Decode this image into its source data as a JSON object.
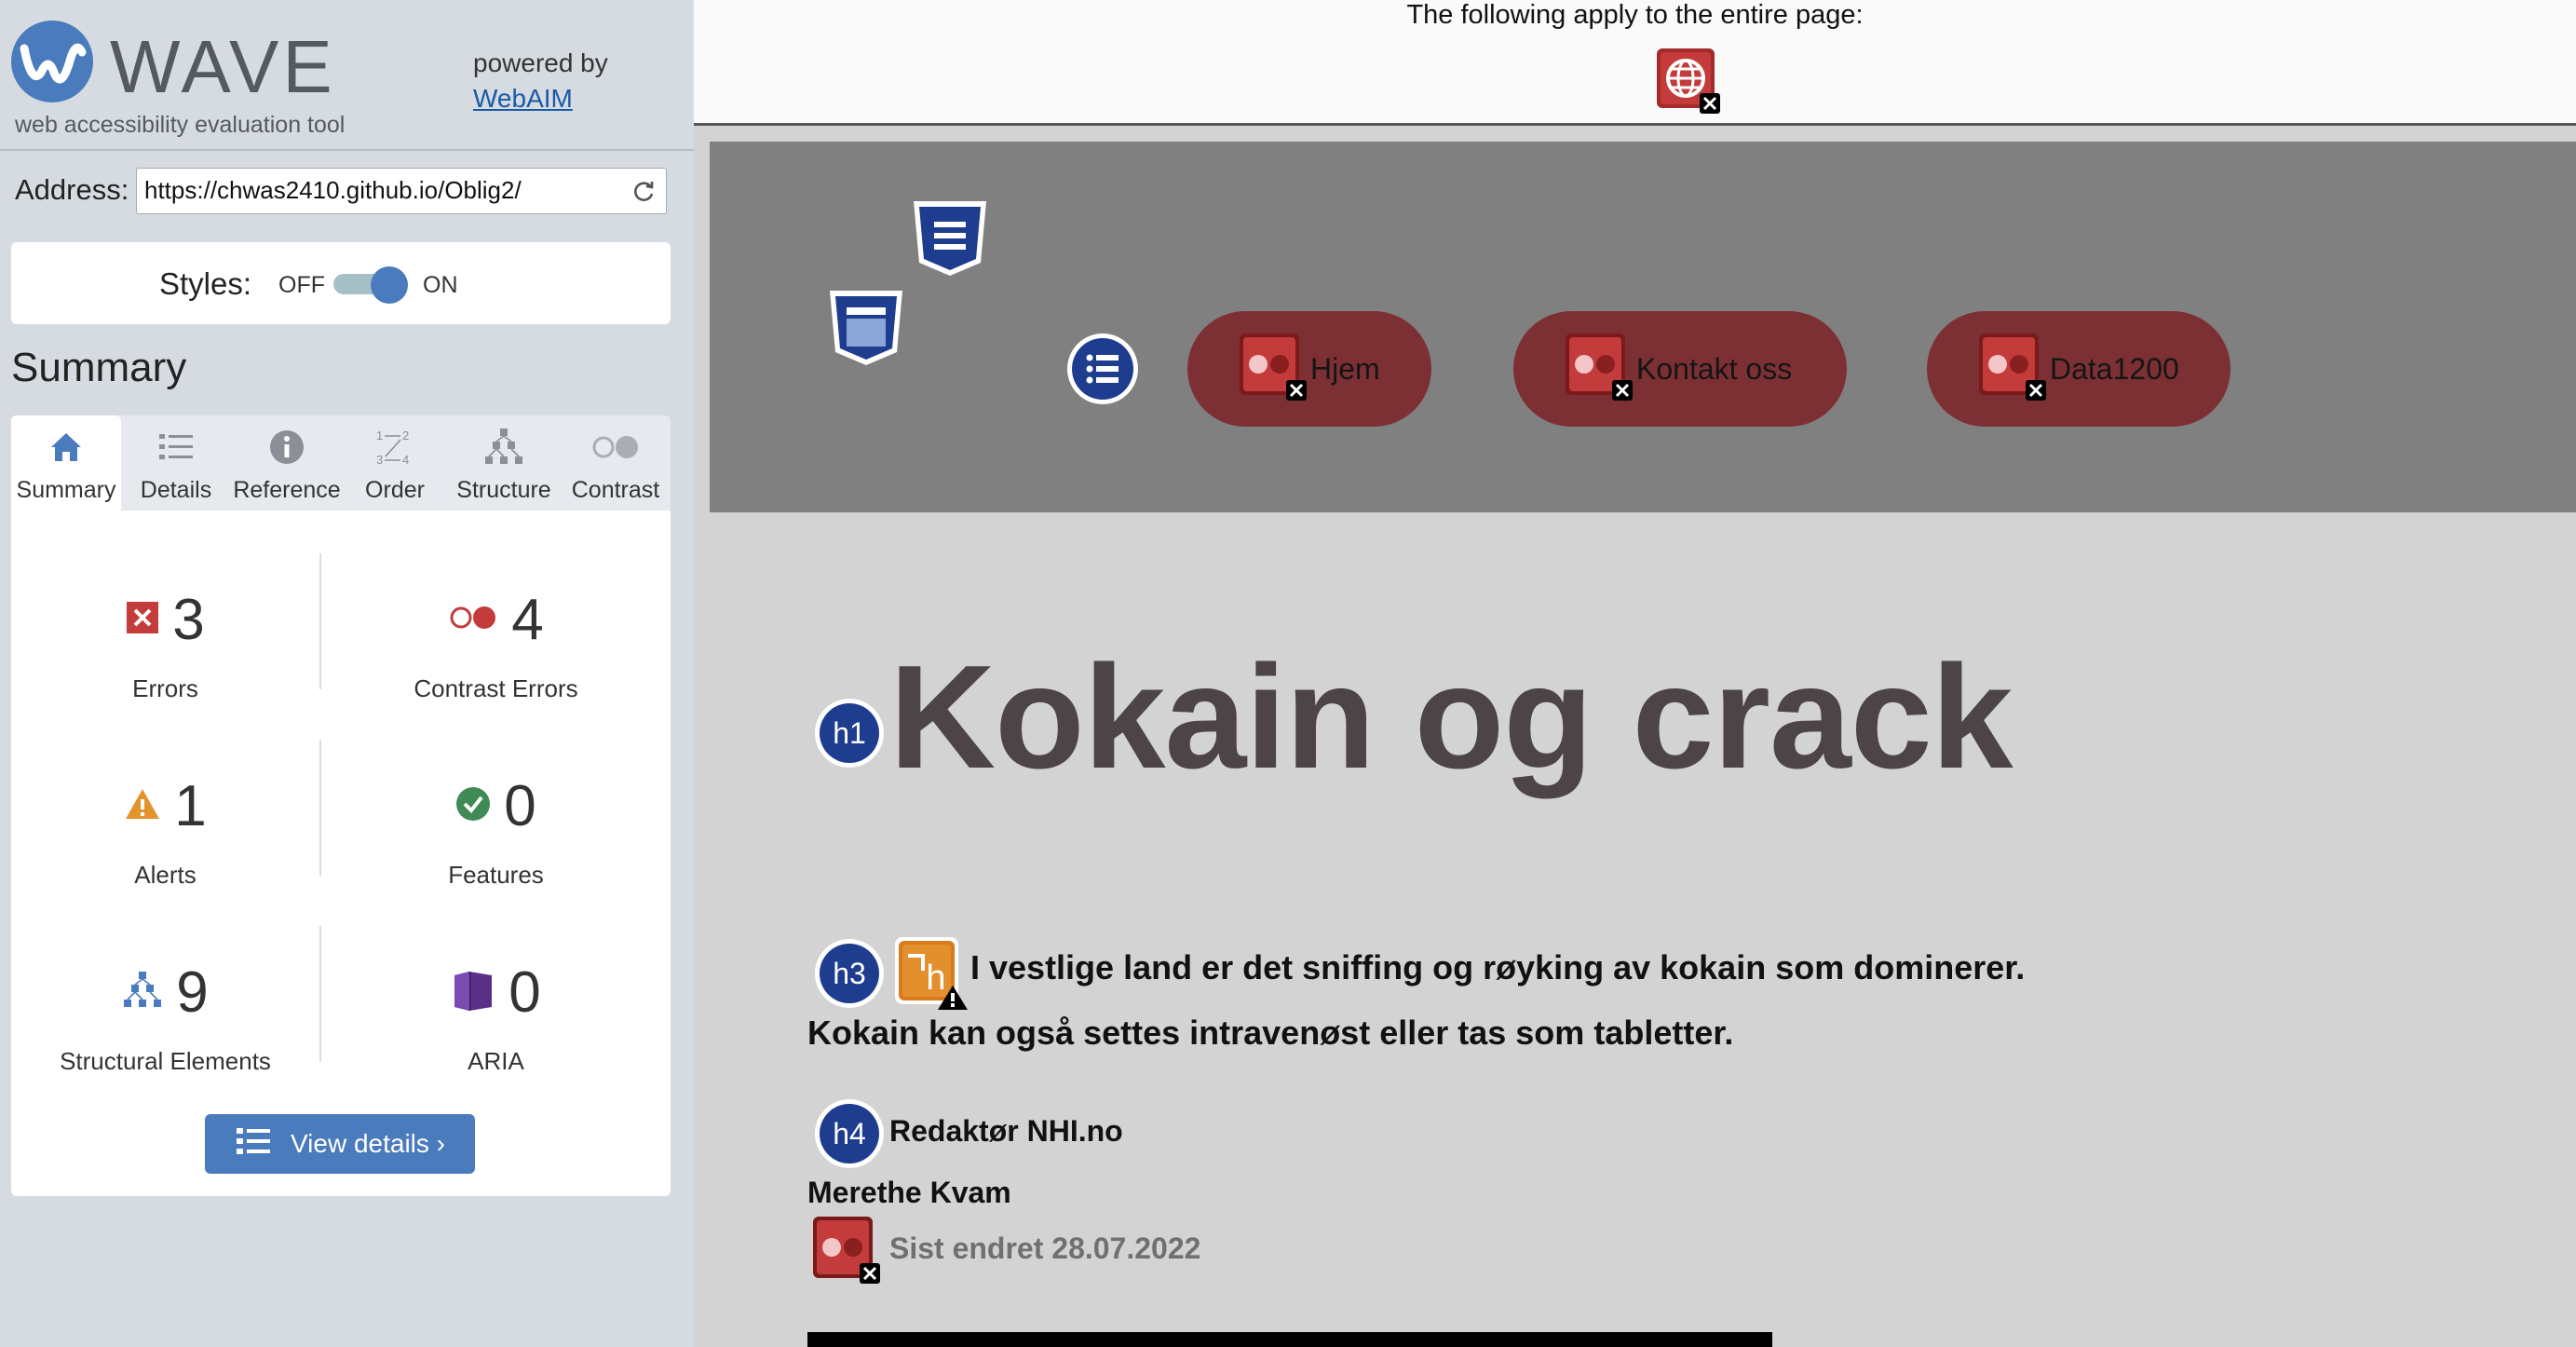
{
  "sidebar": {
    "brand": "WAVE",
    "tagline": "web accessibility evaluation tool",
    "powered_by": "powered by",
    "powered_link": "WebAIM",
    "address_label": "Address:",
    "address_value": "https://chwas2410.github.io/Oblig2/",
    "styles_label": "Styles:",
    "styles_off": "OFF",
    "styles_on": "ON",
    "styles_enabled": true,
    "summary_heading": "Summary",
    "tabs": [
      {
        "label": "Summary",
        "icon": "home-icon",
        "active": true
      },
      {
        "label": "Details",
        "icon": "list-icon",
        "active": false
      },
      {
        "label": "Reference",
        "icon": "info-icon",
        "active": false
      },
      {
        "label": "Order",
        "icon": "order-icon",
        "active": false
      },
      {
        "label": "Structure",
        "icon": "hierarchy-icon",
        "active": false
      },
      {
        "label": "Contrast",
        "icon": "contrast-icon",
        "active": false
      }
    ],
    "stats": {
      "errors": {
        "count": "3",
        "label": "Errors",
        "icon": "error-icon"
      },
      "contrast_errors": {
        "count": "4",
        "label": "Contrast Errors",
        "icon": "contrast-error-icon"
      },
      "alerts": {
        "count": "1",
        "label": "Alerts",
        "icon": "alert-icon"
      },
      "features": {
        "count": "0",
        "label": "Features",
        "icon": "feature-check-icon"
      },
      "structural": {
        "count": "9",
        "label": "Structural Elements",
        "icon": "structure-icon"
      },
      "aria": {
        "count": "0",
        "label": "ARIA",
        "icon": "aria-icon"
      }
    },
    "view_details": "View details ›"
  },
  "main": {
    "top_notice": "The following apply to the entire page:",
    "nav_items": [
      "Hjem",
      "Kontakt oss",
      "Data1200"
    ],
    "heading": "Kokain og crack",
    "lead_line1": "I vestlige land er det sniffing og røyking av kokain som dominerer.",
    "lead_line2": "Kokain kan også settes intravenøst eller tas som tabletter.",
    "editor": "Redaktør NHI.no",
    "author": "Merethe Kvam",
    "updated": "Sist endret 28.07.2022",
    "badges": {
      "h1": "h1",
      "h3": "h3",
      "h4": "h4",
      "alert_h": "h"
    }
  },
  "colors": {
    "accent": "#4a7bbd",
    "sidebar_bg": "#d5dbe1",
    "error_red": "#c33b3b",
    "nav_bg": "#808080",
    "nav_button": "#7c3034",
    "heading_text": "#4c4446"
  }
}
